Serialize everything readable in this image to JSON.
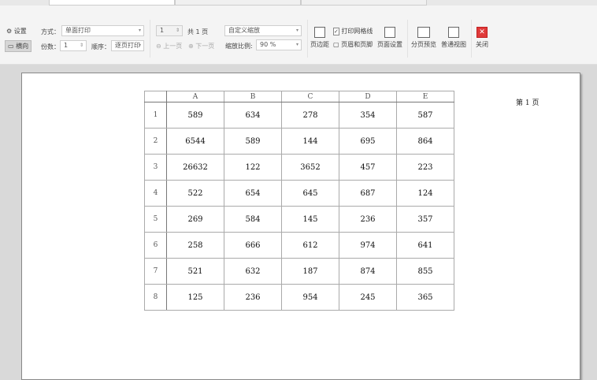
{
  "toolbar": {
    "settings": "设置",
    "landscape": "横向",
    "mode_label": "方式：",
    "mode_value": "单面打印",
    "copies_label": "份数：",
    "copies_value": "1",
    "order_label": "顺序：",
    "order_value": "逐页打印",
    "page_value": "1",
    "total_pages": "共 1 页",
    "prev": "上一页",
    "next": "下一页",
    "zoom_mode": "自定义缩放",
    "zoom_label": "缩放比例:",
    "zoom_value": "90 %",
    "margins": "页边距",
    "print_gridlines": "打印网格线",
    "header_footer": "页眉和页脚",
    "page_setup": "页面设置",
    "page_break_preview": "分页预览",
    "normal_view": "普通视图",
    "close": "关闭"
  },
  "colors": {
    "close": "#e03a3a",
    "accent": "#2e9e4f"
  },
  "sheet": {
    "columns": [
      "A",
      "B",
      "C",
      "D",
      "E"
    ],
    "rows": [
      {
        "n": "1",
        "v": [
          "589",
          "634",
          "278",
          "354",
          "587"
        ]
      },
      {
        "n": "2",
        "v": [
          "6544",
          "589",
          "144",
          "695",
          "864"
        ]
      },
      {
        "n": "3",
        "v": [
          "26632",
          "122",
          "3652",
          "457",
          "223"
        ]
      },
      {
        "n": "4",
        "v": [
          "522",
          "654",
          "645",
          "687",
          "124"
        ]
      },
      {
        "n": "5",
        "v": [
          "269",
          "584",
          "145",
          "236",
          "357"
        ]
      },
      {
        "n": "6",
        "v": [
          "258",
          "666",
          "612",
          "974",
          "641"
        ]
      },
      {
        "n": "7",
        "v": [
          "521",
          "632",
          "187",
          "874",
          "855"
        ]
      },
      {
        "n": "8",
        "v": [
          "125",
          "236",
          "954",
          "245",
          "365"
        ]
      }
    ]
  },
  "page_number": "第 1 页"
}
